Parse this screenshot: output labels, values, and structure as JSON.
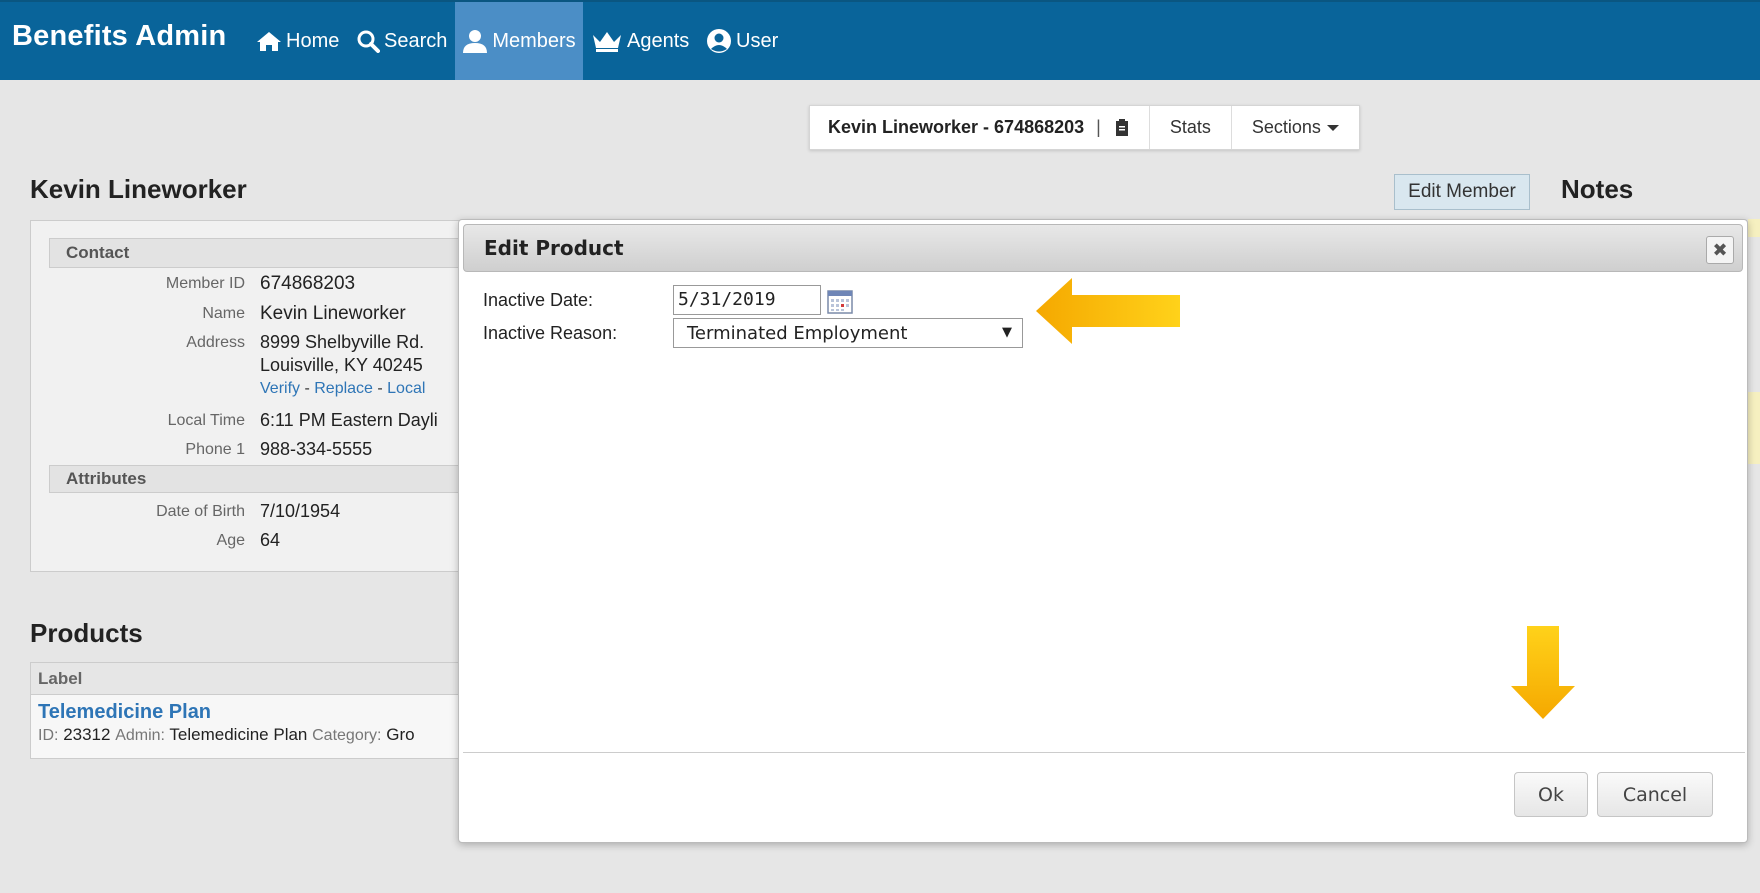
{
  "app": {
    "title": "Benefits Admin"
  },
  "nav": {
    "home": "Home",
    "search": "Search",
    "members": "Members",
    "agents": "Agents",
    "user": "User"
  },
  "member_toolbar": {
    "title": "Kevin Lineworker - 674868203",
    "separator": "|",
    "stats": "Stats",
    "sections": "Sections"
  },
  "page": {
    "title": "Kevin Lineworker",
    "edit_member": "Edit Member",
    "notes_title": "Notes"
  },
  "contact": {
    "header": "Contact",
    "member_id_label": "Member ID",
    "member_id": "674868203",
    "name_label": "Name",
    "name": "Kevin Lineworker",
    "address_label": "Address",
    "address_line1": "8999 Shelbyville Rd.",
    "address_line2": "Louisville, KY 40245",
    "links": {
      "verify": "Verify",
      "replace": "Replace",
      "local": "Local",
      "sep": " - "
    },
    "local_time_label": "Local Time",
    "local_time": "6:11 PM Eastern Dayli",
    "phone_label": "Phone 1",
    "phone": "988-334-5555"
  },
  "attributes": {
    "header": "Attributes",
    "dob_label": "Date of Birth",
    "dob": "7/10/1954",
    "age_label": "Age",
    "age": "64"
  },
  "products": {
    "title": "Products",
    "column_label": "Label",
    "item_name": "Telemedicine Plan",
    "id_key": "ID:",
    "id": "23312",
    "admin_key": "Admin:",
    "admin": "Telemedicine Plan",
    "category_key": "Category:",
    "category": "Gro"
  },
  "modal": {
    "title": "Edit Product",
    "close_glyph": "✖",
    "inactive_date_label": "Inactive Date:",
    "inactive_date": "5/31/2019",
    "inactive_reason_label": "Inactive Reason:",
    "inactive_reason": "Terminated Employment",
    "ok": "Ok",
    "cancel": "Cancel"
  },
  "colors": {
    "nav_bg": "#09649a",
    "nav_active": "#4b8ec6",
    "link": "#2e75b6",
    "arrow": "#f5b400"
  }
}
